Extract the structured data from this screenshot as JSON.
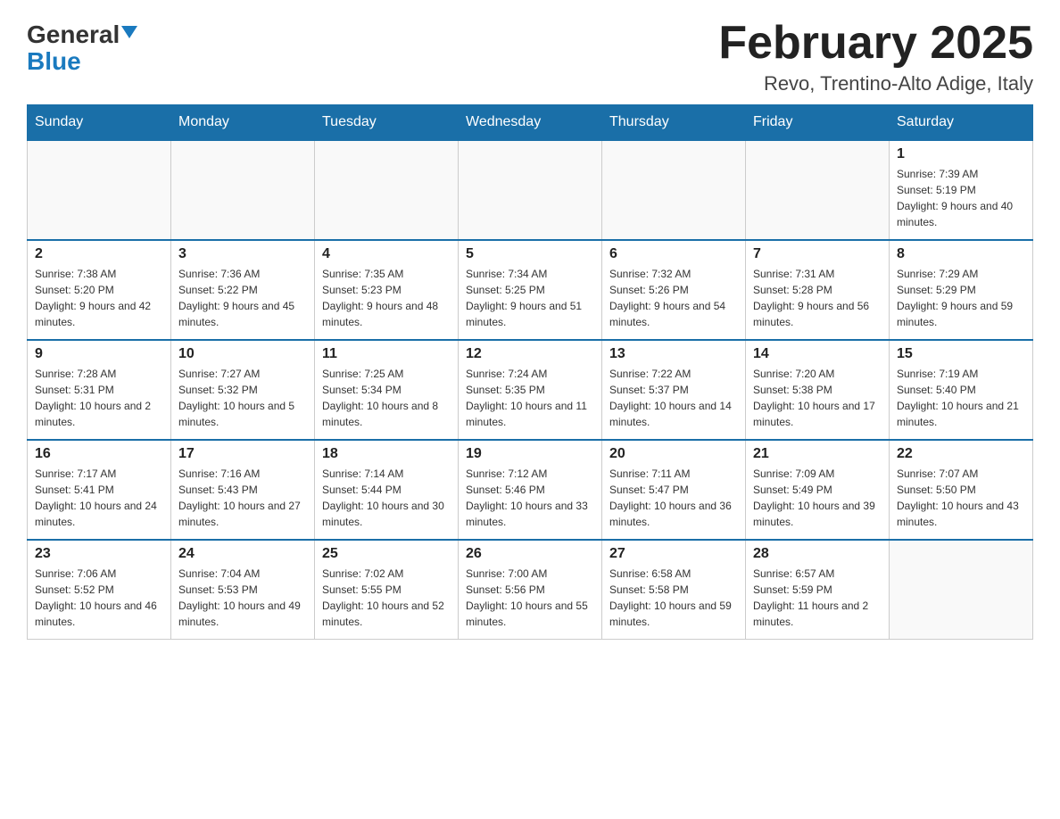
{
  "logo": {
    "text_general": "General",
    "text_blue": "Blue",
    "arrow": "▼"
  },
  "title": {
    "month_year": "February 2025",
    "location": "Revo, Trentino-Alto Adige, Italy"
  },
  "weekdays": [
    "Sunday",
    "Monday",
    "Tuesday",
    "Wednesday",
    "Thursday",
    "Friday",
    "Saturday"
  ],
  "weeks": [
    [
      {
        "day": "",
        "info": ""
      },
      {
        "day": "",
        "info": ""
      },
      {
        "day": "",
        "info": ""
      },
      {
        "day": "",
        "info": ""
      },
      {
        "day": "",
        "info": ""
      },
      {
        "day": "",
        "info": ""
      },
      {
        "day": "1",
        "info": "Sunrise: 7:39 AM\nSunset: 5:19 PM\nDaylight: 9 hours and 40 minutes."
      }
    ],
    [
      {
        "day": "2",
        "info": "Sunrise: 7:38 AM\nSunset: 5:20 PM\nDaylight: 9 hours and 42 minutes."
      },
      {
        "day": "3",
        "info": "Sunrise: 7:36 AM\nSunset: 5:22 PM\nDaylight: 9 hours and 45 minutes."
      },
      {
        "day": "4",
        "info": "Sunrise: 7:35 AM\nSunset: 5:23 PM\nDaylight: 9 hours and 48 minutes."
      },
      {
        "day": "5",
        "info": "Sunrise: 7:34 AM\nSunset: 5:25 PM\nDaylight: 9 hours and 51 minutes."
      },
      {
        "day": "6",
        "info": "Sunrise: 7:32 AM\nSunset: 5:26 PM\nDaylight: 9 hours and 54 minutes."
      },
      {
        "day": "7",
        "info": "Sunrise: 7:31 AM\nSunset: 5:28 PM\nDaylight: 9 hours and 56 minutes."
      },
      {
        "day": "8",
        "info": "Sunrise: 7:29 AM\nSunset: 5:29 PM\nDaylight: 9 hours and 59 minutes."
      }
    ],
    [
      {
        "day": "9",
        "info": "Sunrise: 7:28 AM\nSunset: 5:31 PM\nDaylight: 10 hours and 2 minutes."
      },
      {
        "day": "10",
        "info": "Sunrise: 7:27 AM\nSunset: 5:32 PM\nDaylight: 10 hours and 5 minutes."
      },
      {
        "day": "11",
        "info": "Sunrise: 7:25 AM\nSunset: 5:34 PM\nDaylight: 10 hours and 8 minutes."
      },
      {
        "day": "12",
        "info": "Sunrise: 7:24 AM\nSunset: 5:35 PM\nDaylight: 10 hours and 11 minutes."
      },
      {
        "day": "13",
        "info": "Sunrise: 7:22 AM\nSunset: 5:37 PM\nDaylight: 10 hours and 14 minutes."
      },
      {
        "day": "14",
        "info": "Sunrise: 7:20 AM\nSunset: 5:38 PM\nDaylight: 10 hours and 17 minutes."
      },
      {
        "day": "15",
        "info": "Sunrise: 7:19 AM\nSunset: 5:40 PM\nDaylight: 10 hours and 21 minutes."
      }
    ],
    [
      {
        "day": "16",
        "info": "Sunrise: 7:17 AM\nSunset: 5:41 PM\nDaylight: 10 hours and 24 minutes."
      },
      {
        "day": "17",
        "info": "Sunrise: 7:16 AM\nSunset: 5:43 PM\nDaylight: 10 hours and 27 minutes."
      },
      {
        "day": "18",
        "info": "Sunrise: 7:14 AM\nSunset: 5:44 PM\nDaylight: 10 hours and 30 minutes."
      },
      {
        "day": "19",
        "info": "Sunrise: 7:12 AM\nSunset: 5:46 PM\nDaylight: 10 hours and 33 minutes."
      },
      {
        "day": "20",
        "info": "Sunrise: 7:11 AM\nSunset: 5:47 PM\nDaylight: 10 hours and 36 minutes."
      },
      {
        "day": "21",
        "info": "Sunrise: 7:09 AM\nSunset: 5:49 PM\nDaylight: 10 hours and 39 minutes."
      },
      {
        "day": "22",
        "info": "Sunrise: 7:07 AM\nSunset: 5:50 PM\nDaylight: 10 hours and 43 minutes."
      }
    ],
    [
      {
        "day": "23",
        "info": "Sunrise: 7:06 AM\nSunset: 5:52 PM\nDaylight: 10 hours and 46 minutes."
      },
      {
        "day": "24",
        "info": "Sunrise: 7:04 AM\nSunset: 5:53 PM\nDaylight: 10 hours and 49 minutes."
      },
      {
        "day": "25",
        "info": "Sunrise: 7:02 AM\nSunset: 5:55 PM\nDaylight: 10 hours and 52 minutes."
      },
      {
        "day": "26",
        "info": "Sunrise: 7:00 AM\nSunset: 5:56 PM\nDaylight: 10 hours and 55 minutes."
      },
      {
        "day": "27",
        "info": "Sunrise: 6:58 AM\nSunset: 5:58 PM\nDaylight: 10 hours and 59 minutes."
      },
      {
        "day": "28",
        "info": "Sunrise: 6:57 AM\nSunset: 5:59 PM\nDaylight: 11 hours and 2 minutes."
      },
      {
        "day": "",
        "info": ""
      }
    ]
  ]
}
